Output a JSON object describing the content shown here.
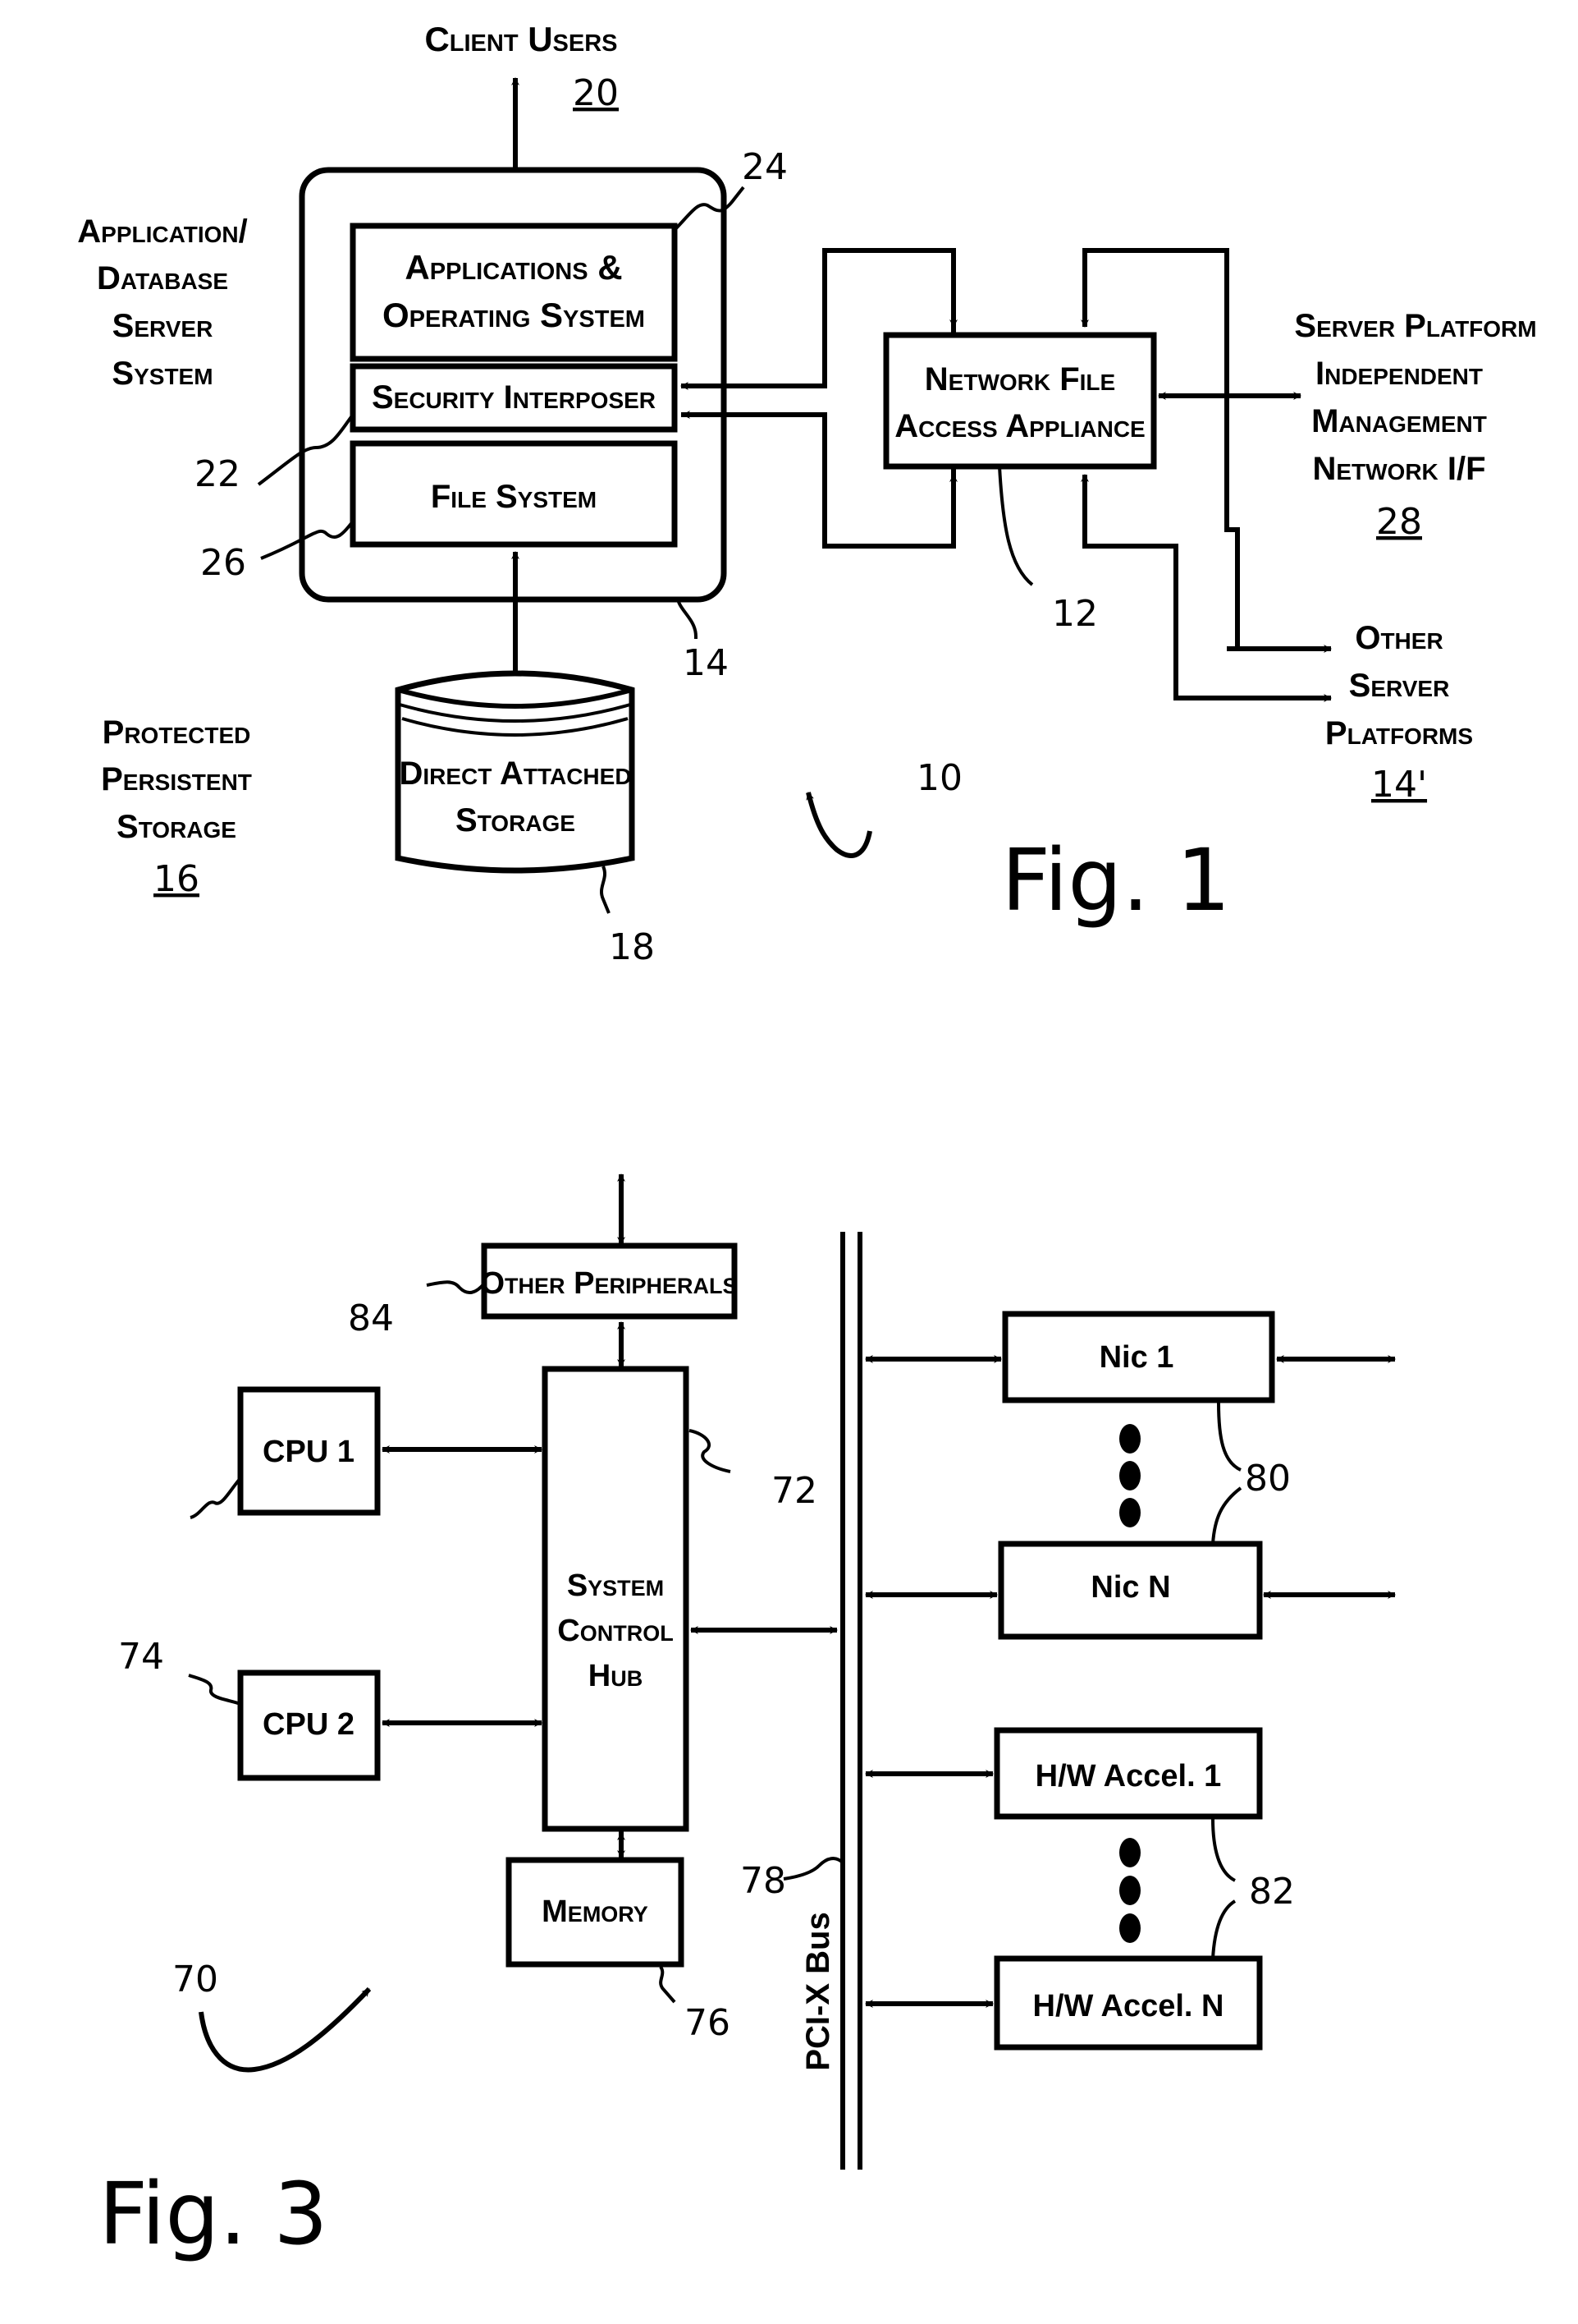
{
  "fig1": {
    "caption": "Fig. 1",
    "system_ref": "10",
    "client_users": {
      "line1": "Client Users",
      "ref": "20"
    },
    "server_system_label": [
      "Application/",
      "Database",
      "Server",
      "System"
    ],
    "server_ref": "14",
    "apps_os": {
      "line1": "Applications &",
      "line2": "Operating System",
      "ref": "24"
    },
    "security_interposer": {
      "label": "Security Interposer",
      "ref": "22"
    },
    "file_system": {
      "label": "File System",
      "ref": "26"
    },
    "nfa": {
      "line1": "Network File",
      "line2": "Access Appliance",
      "ref": "12"
    },
    "mgmt_if": {
      "lines": [
        "Server Platform",
        "Independent",
        "Management",
        "Network I/F"
      ],
      "ref": "28"
    },
    "other_servers": {
      "lines": [
        "Other",
        "Server",
        "Platforms"
      ],
      "ref": "14'"
    },
    "protected_storage": {
      "lines": [
        "Protected",
        "Persistent",
        "Storage"
      ],
      "ref": "16"
    },
    "das": {
      "line1": "Direct Attached",
      "line2": "Storage",
      "ref": "18"
    }
  },
  "fig3": {
    "caption": "Fig. 3",
    "system_ref": "70",
    "other_peripherals": {
      "label": "Other Peripherals",
      "ref": "84"
    },
    "cpu1": {
      "label": "CPU 1"
    },
    "cpu2": {
      "label": "CPU 2"
    },
    "cpu_ref": "74",
    "hub": {
      "lines": [
        "System",
        "Control",
        "Hub"
      ],
      "ref": "72"
    },
    "memory": {
      "label": "Memory",
      "ref": "76"
    },
    "bus": {
      "label": "PCI-X Bus",
      "ref": "78"
    },
    "nic1": {
      "label": "Nic 1"
    },
    "nicn": {
      "label": "Nic N"
    },
    "nic_ref": "80",
    "accel1": {
      "label": "H/W Accel. 1"
    },
    "acceln": {
      "label": "H/W Accel. N"
    },
    "accel_ref": "82"
  }
}
